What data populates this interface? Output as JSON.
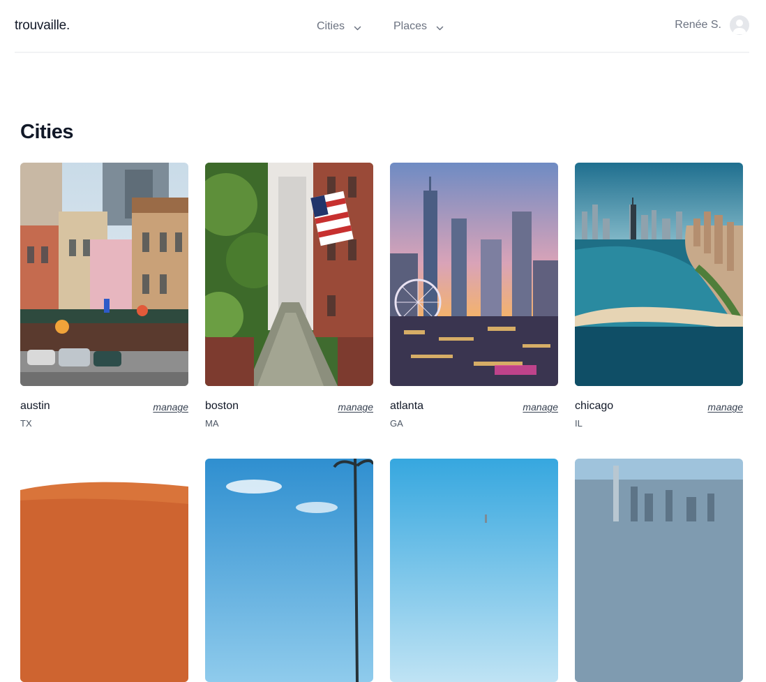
{
  "header": {
    "logo": "trouvaille.",
    "nav": [
      {
        "label": "Cities",
        "icon": "chevron-down-icon"
      },
      {
        "label": "Places",
        "icon": "chevron-down-icon"
      }
    ],
    "user": {
      "name": "Renée S.",
      "avatar_icon": "user-avatar-icon"
    }
  },
  "main": {
    "title": "Cities",
    "cities": [
      {
        "name": "austin",
        "state": "TX",
        "action": "manage"
      },
      {
        "name": "boston",
        "state": "MA",
        "action": "manage"
      },
      {
        "name": "atlanta",
        "state": "GA",
        "action": "manage"
      },
      {
        "name": "chicago",
        "state": "IL",
        "action": "manage"
      },
      {
        "name": "",
        "state": "",
        "action": ""
      },
      {
        "name": "",
        "state": "",
        "action": ""
      },
      {
        "name": "",
        "state": "",
        "action": ""
      },
      {
        "name": "",
        "state": "",
        "action": ""
      }
    ]
  },
  "colors": {
    "text_primary": "#111827",
    "text_muted": "#6b7280",
    "divider": "#f1f2f4"
  }
}
